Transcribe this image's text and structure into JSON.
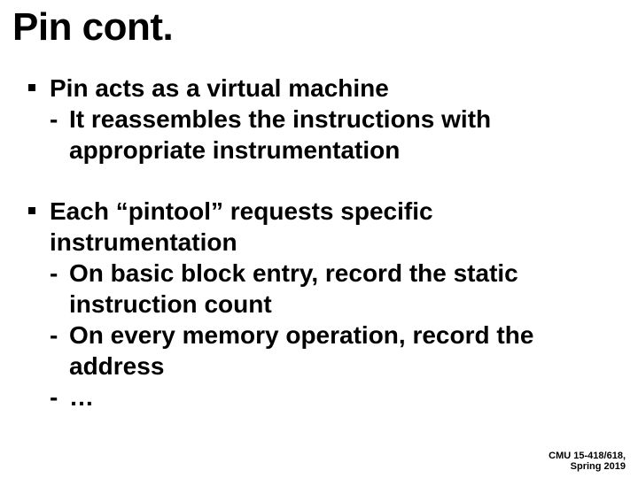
{
  "title": "Pin cont.",
  "bullets": [
    {
      "text": "Pin acts as a virtual machine",
      "subs": [
        "It reassembles the instructions with appropriate instrumentation"
      ]
    },
    {
      "text": "Each “pintool” requests specific instrumentation",
      "subs": [
        "On basic block entry, record the static instruction count",
        "On every memory operation, record the address",
        "…"
      ]
    }
  ],
  "footer": {
    "line1": "CMU 15-418/618,",
    "line2": "Spring 2019"
  }
}
